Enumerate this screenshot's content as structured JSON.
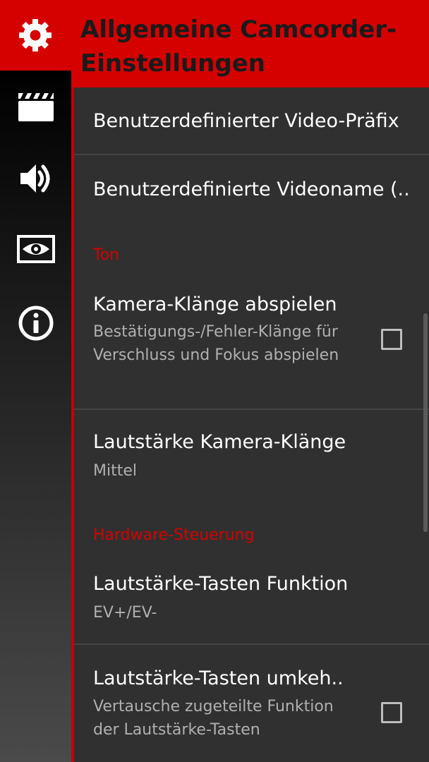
{
  "header": {
    "title": "Allgemeine Camcorder-Einstellungen",
    "icon": "gear-icon",
    "bg_color": "#d50000"
  },
  "sidebar": {
    "items": [
      {
        "icon": "clapperboard-icon",
        "label": ""
      },
      {
        "icon": "speaker-icon",
        "label": ""
      },
      {
        "icon": "eye-icon",
        "label": ""
      },
      {
        "icon": "info-icon",
        "label": ""
      }
    ]
  },
  "settings": {
    "video_prefix": {
      "title": "Benutzerdefinierter Video-Präfix"
    },
    "video_name": {
      "title": "Benutzerdefinierte Videoname (.."
    },
    "category_ton": "Ton",
    "camera_sounds": {
      "title": "Kamera-Klänge abspielen",
      "summary": "Bestätigungs-/Fehler-Klänge für Verschluss und Fokus abspielen",
      "checked": false
    },
    "sound_volume": {
      "title": "Lautstärke Kamera-Klänge",
      "summary": "Mittel"
    },
    "category_hardware": "Hardware-Steuerung",
    "volume_keys": {
      "title": "Lautstärke-Tasten Funktion",
      "summary": "EV+/EV-"
    },
    "invert_volume_keys": {
      "title": "Lautstärke-Tasten umkeh..",
      "summary": "Vertausche zugeteilte Funktion der Lautstärke-Tasten",
      "checked": false
    }
  },
  "colors": {
    "accent": "#d50000",
    "background": "#303030",
    "text_primary": "#ffffff",
    "text_secondary": "#b0b0b0"
  }
}
